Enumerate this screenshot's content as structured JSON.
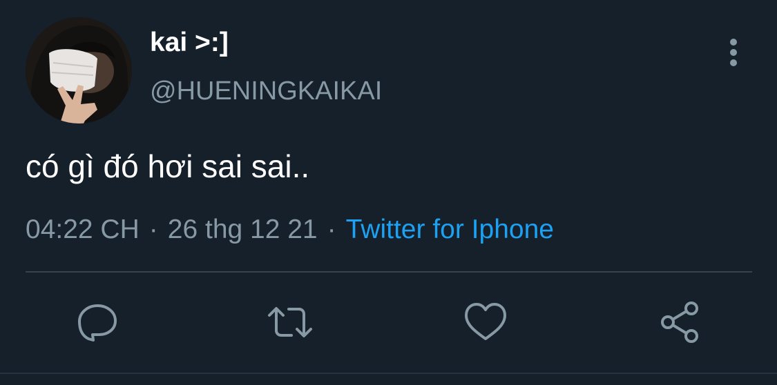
{
  "tweet": {
    "user": {
      "display_name": "kai >:]",
      "handle": "@HUENINGKAIKAI",
      "avatar_icon": "profile-photo"
    },
    "text": "có gì đó hơi sai sai..",
    "meta": {
      "time": "04:22 CH",
      "separator": "·",
      "date": "26 thg 12 21",
      "source": "Twitter for Iphone"
    },
    "actions": {
      "reply_icon": "reply-icon",
      "retweet_icon": "retweet-icon",
      "like_icon": "heart-icon",
      "share_icon": "share-icon",
      "more_icon": "more-vertical-icon"
    }
  },
  "colors": {
    "background": "#15202b",
    "primary_text": "#ffffff",
    "secondary_text": "#8899a6",
    "link": "#1da1f2",
    "divider": "#38444d"
  }
}
